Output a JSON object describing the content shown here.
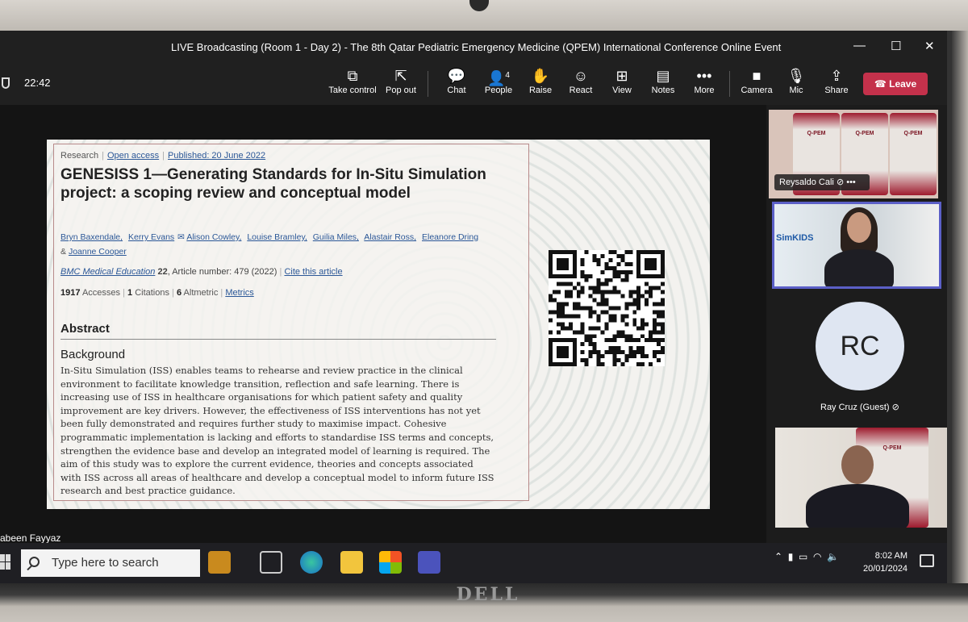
{
  "window": {
    "title": "LIVE Broadcasting (Room 1 - Day 2) - The 8th Qatar Pediatric Emergency Medicine (QPEM) International Conference Online Event",
    "minimize": "—",
    "maximize": "☐",
    "close": "✕"
  },
  "toolbar": {
    "time": "22:42",
    "take_control": "Take control",
    "pop_out": "Pop out",
    "chat": "Chat",
    "people": "People",
    "people_count": "4",
    "raise": "Raise",
    "react": "React",
    "view": "View",
    "notes": "Notes",
    "more": "More",
    "camera": "Camera",
    "mic": "Mic",
    "share": "Share",
    "leave": "Leave"
  },
  "slide": {
    "meta": {
      "type": "Research",
      "access": "Open access",
      "published": "Published: 20 June 2022"
    },
    "title": "GENESISS 1—Generating Standards for In-Situ Simulation project: a scoping review and conceptual model",
    "authors": [
      "Bryn Baxendale,",
      "Kerry Evans",
      "Alison Cowley,",
      "Louise Bramley,",
      "Guilia Miles,",
      "Alastair Ross,",
      "Eleanore Dring"
    ],
    "authors_amp": "&",
    "last_author": "Joanne Cooper",
    "journal": "BMC Medical Education",
    "volume": "22",
    "article_number": ", Article number: 479 (2022)",
    "cite": "Cite this article",
    "accesses_count": "1917",
    "accesses_label": "Accesses",
    "citations_count": "1",
    "citations_label": "Citations",
    "altmetric_count": "6",
    "altmetric_label": "Altmetric",
    "metrics_link": "Metrics",
    "abstract_heading": "Abstract",
    "background_heading": "Background",
    "abstract_text": "In-Situ Simulation (ISS) enables teams to rehearse and review practice in the clinical environment to facilitate knowledge transition, reflection and safe learning. There is increasing use of ISS in healthcare organisations for which patient safety and quality improvement are key drivers. However, the effectiveness of ISS interventions has not yet been fully demonstrated and requires further study to maximise impact. Cohesive programmatic implementation is lacking and efforts to standardise ISS terms and concepts, strengthen the evidence base and develop an integrated model of learning is required. The aim of this study was to explore the current evidence, theories and concepts associated with ISS across all areas of healthcare and develop a conceptual model to inform future ISS research and best practice guidance."
  },
  "participants": {
    "p1_name": "Reysaldo Cali",
    "p1_more": "•••",
    "banner_text": "Q-PEM",
    "simkids": "SimKIDS",
    "rc_initials": "RC",
    "rc_name": "Ray Cruz (Guest)"
  },
  "presenter_name": "abeen Fayyaz",
  "taskbar": {
    "search_placeholder": "Type here to search",
    "time": "8:02 AM",
    "date": "20/01/2024"
  },
  "bezel": {
    "brand": "DELL"
  },
  "colors": {
    "leave": "#c4314b",
    "active_speaker": "#5b5fc7",
    "taskbar": "#1f1f23"
  }
}
